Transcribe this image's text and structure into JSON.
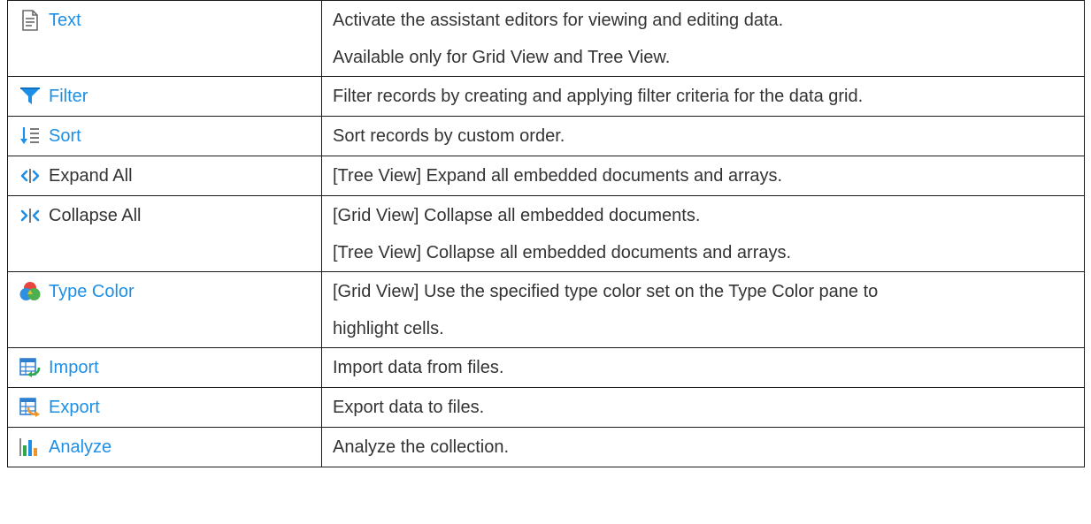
{
  "rows": [
    {
      "icon": "text-document-icon",
      "label": "Text",
      "is_link": true,
      "desc": [
        "Activate the assistant editors for viewing and editing data.",
        "Available only for Grid View and Tree View."
      ]
    },
    {
      "icon": "filter-funnel-icon",
      "label": "Filter",
      "is_link": true,
      "desc": [
        "Filter records by creating and applying filter criteria for the data grid."
      ]
    },
    {
      "icon": "sort-icon",
      "label": "Sort",
      "is_link": true,
      "desc": [
        "Sort records by custom order."
      ]
    },
    {
      "icon": "expand-all-icon",
      "label": "Expand All",
      "is_link": false,
      "desc": [
        "[Tree View] Expand all embedded documents and arrays."
      ]
    },
    {
      "icon": "collapse-all-icon",
      "label": "Collapse All",
      "is_link": false,
      "desc": [
        "[Grid View] Collapse all embedded documents.",
        "[Tree View] Collapse all embedded documents and arrays."
      ]
    },
    {
      "icon": "type-color-icon",
      "label": "Type Color",
      "is_link": true,
      "desc": [
        "[Grid View] Use the specified type color set on the Type Color pane to",
        "highlight cells."
      ]
    },
    {
      "icon": "import-icon",
      "label": "Import",
      "is_link": true,
      "desc": [
        "Import data from files."
      ]
    },
    {
      "icon": "export-icon",
      "label": "Export",
      "is_link": true,
      "desc": [
        "Export data to files."
      ]
    },
    {
      "icon": "analyze-chart-icon",
      "label": "Analyze",
      "is_link": true,
      "desc": [
        "Analyze the collection."
      ]
    }
  ],
  "colors": {
    "link": "#1e8fe6",
    "text": "#333333",
    "border": "#1a1a1a"
  }
}
